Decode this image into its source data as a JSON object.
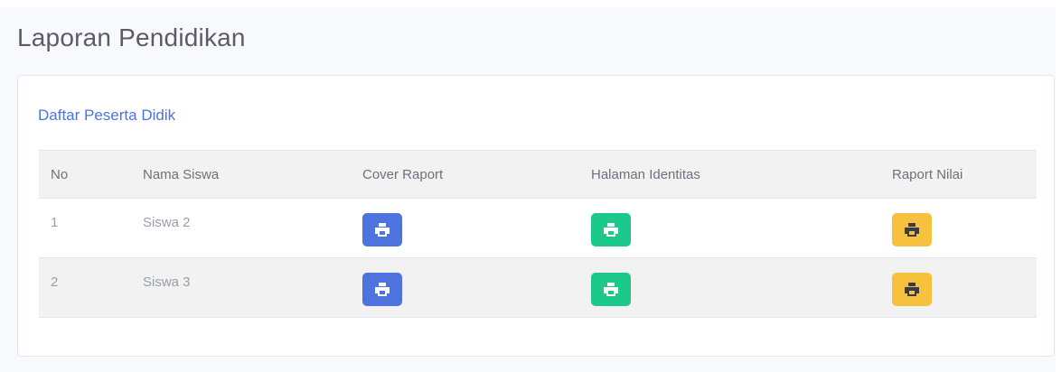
{
  "page": {
    "title": "Laporan Pendidikan"
  },
  "card": {
    "title": "Daftar Peserta Didik"
  },
  "table": {
    "headers": {
      "no": "No",
      "name": "Nama Siswa",
      "cover": "Cover Raport",
      "identity": "Halaman Identitas",
      "grades": "Raport Nilai"
    },
    "rows": [
      {
        "no": "1",
        "name": "Siswa 2"
      },
      {
        "no": "2",
        "name": "Siswa 3"
      }
    ]
  },
  "buttons": {
    "cover": {
      "icon": "print-icon",
      "color": "#4e73df",
      "icon_color": "#ffffff"
    },
    "identity": {
      "icon": "print-icon",
      "color": "#1cc88a",
      "icon_color": "#ffffff"
    },
    "grades": {
      "icon": "print-icon",
      "color": "#f6c23e",
      "icon_color": "#3a3b45"
    }
  }
}
